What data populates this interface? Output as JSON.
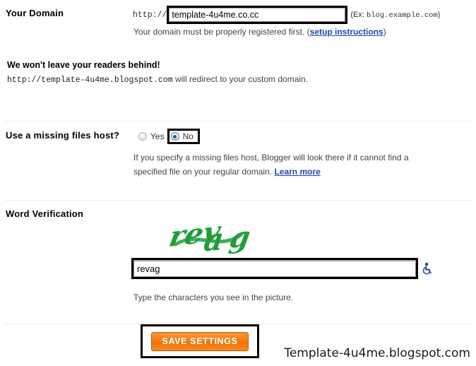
{
  "domain_section": {
    "label": "Your Domain",
    "protocol_prefix": "http://",
    "input_value": "template-4u4me.co.cc",
    "input_placeholder": "",
    "example_prefix": "(Ex: ",
    "example_domain": "blog.example.com",
    "example_suffix": ")",
    "note_text": "Your domain must be properly registered first. (",
    "note_link": "setup instructions",
    "note_suffix": ")"
  },
  "readers_section": {
    "heading": "We won't leave your readers behind!",
    "redirect_url": "http://template-4u4me.blogspot.com",
    "redirect_rest": " will redirect to your custom domain."
  },
  "missing_files_section": {
    "label": "Use a missing files host?",
    "options": [
      {
        "label": "Yes",
        "value": "yes",
        "selected": false
      },
      {
        "label": "No",
        "value": "no",
        "selected": true
      }
    ],
    "help_text": "If you specify a missing files host, Blogger will look there if it cannot find a specified file on your regular domain. ",
    "help_link": "Learn more"
  },
  "word_verification_section": {
    "label": "Word Verification",
    "captcha_text": "revag",
    "captcha_color": "#1f9d3a",
    "input_value": "revag",
    "input_placeholder": "",
    "accessibility_icon": "wheelchair-accessibility-icon",
    "help_text": "Type the characters you see in the picture."
  },
  "footer": {
    "save_label": "SAVE SETTINGS",
    "save_button_color": "#f57c12",
    "watermark": "Template-4u4me.blogspot.com"
  }
}
